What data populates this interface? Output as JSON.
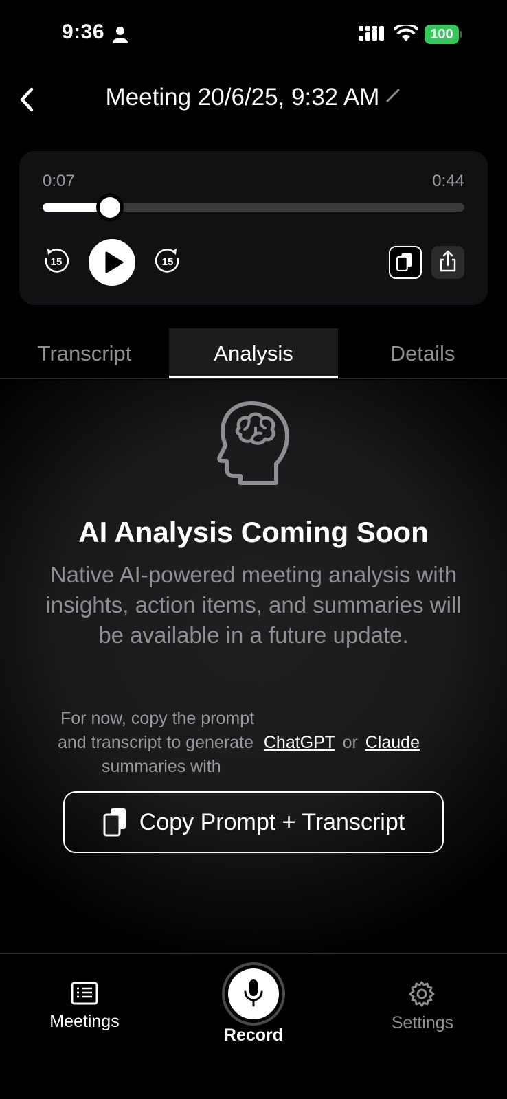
{
  "status_bar": {
    "time": "9:36",
    "battery": "100"
  },
  "header": {
    "title": "Meeting 20/6/25, 9:32 AM"
  },
  "player": {
    "current_time": "0:07",
    "total_time": "0:44",
    "progress": 0.16,
    "skip_back_seconds": "15",
    "skip_forward_seconds": "15"
  },
  "tabs": [
    {
      "label": "Transcript",
      "active": false
    },
    {
      "label": "Analysis",
      "active": true
    },
    {
      "label": "Details",
      "active": false
    }
  ],
  "analysis": {
    "title": "AI Analysis Coming Soon",
    "description": "Native AI-powered meeting analysis with insights, action items, and summaries will be available in a future update.",
    "hint_line1": "For now, copy the prompt",
    "hint_line2": "and transcript to generate",
    "hint_link1": "ChatGPT",
    "hint_or": "or",
    "hint_link2": "Claude",
    "hint_line3": "summaries with",
    "copy_button_label": "Copy Prompt + Transcript"
  },
  "bottom_nav": {
    "meetings": "Meetings",
    "record": "Record",
    "settings": "Settings"
  },
  "colors": {
    "background": "#000000",
    "accent": "#ffffff",
    "muted_text": "#8e8e93",
    "battery": "#34c759"
  }
}
